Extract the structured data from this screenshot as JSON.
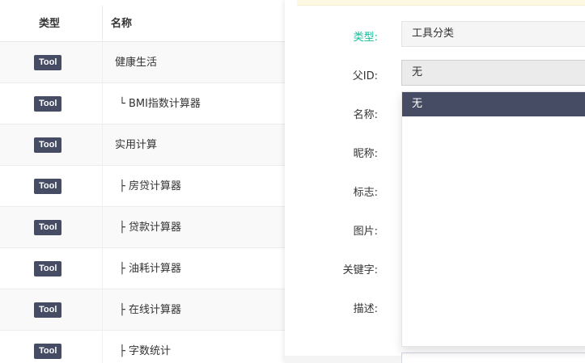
{
  "table": {
    "headers": {
      "type": "类型",
      "name": "名称"
    },
    "rows": [
      {
        "type": "Tool",
        "name": "健康生活"
      },
      {
        "type": "Tool",
        "name": "└ BMI指数计算器"
      },
      {
        "type": "Tool",
        "name": "实用计算"
      },
      {
        "type": "Tool",
        "name": "├ 房贷计算器"
      },
      {
        "type": "Tool",
        "name": "├ 贷款计算器"
      },
      {
        "type": "Tool",
        "name": "├ 油耗计算器"
      },
      {
        "type": "Tool",
        "name": "├ 在线计算器"
      },
      {
        "type": "Tool",
        "name": "├ 字数统计"
      }
    ]
  },
  "form": {
    "labels": {
      "type": "类型:",
      "pid": "父ID:",
      "name": "名称:",
      "nickname": "昵称:",
      "flag": "标志:",
      "image": "图片:",
      "keywords": "关键字:",
      "description": "描述:"
    },
    "type_value": "工具分类",
    "pid_value": "无",
    "pid_options": [
      "无"
    ]
  },
  "colors": {
    "badge": "#464c64",
    "active_label": "#18bc9c",
    "dropdown_selected": "#464c64"
  }
}
